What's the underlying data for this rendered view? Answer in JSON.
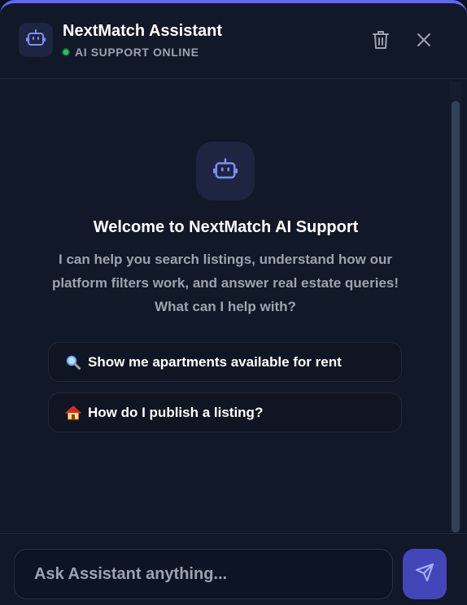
{
  "header": {
    "title": "NextMatch Assistant",
    "status": "AI SUPPORT ONLINE",
    "avatar_icon": "robot-icon",
    "actions": [
      "trash-icon",
      "close-icon"
    ]
  },
  "welcome": {
    "title": "Welcome to NextMatch AI Support",
    "description": "I can help you search listings, understand how our platform filters work, and answer real estate queries! What can I help with?"
  },
  "suggestions": [
    {
      "icon": "magnifier-emoji",
      "label": "Show me apartments available for rent"
    },
    {
      "icon": "house-emoji",
      "label": "How do I publish a listing?"
    }
  ],
  "composer": {
    "placeholder": "Ask Assistant anything...",
    "value": "",
    "send_icon": "send-icon"
  },
  "colors": {
    "accent": "#6366f1",
    "online": "#22c55e",
    "background": "#111827"
  }
}
